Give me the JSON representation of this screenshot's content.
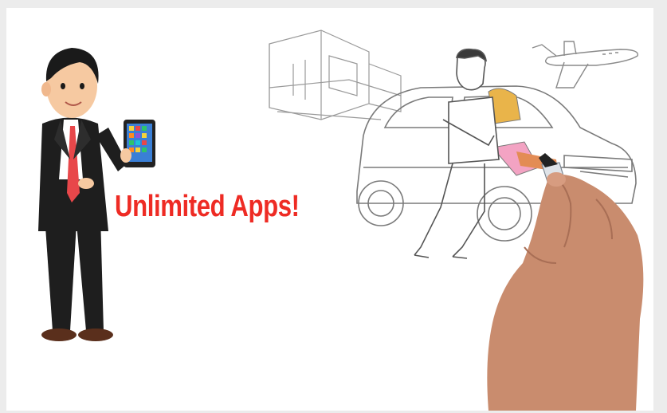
{
  "headline": {
    "text": "Unlimited Apps!"
  },
  "colors": {
    "headline": "#ee2b24",
    "background": "#ffffff",
    "border": "#ececec",
    "suit": "#1e1e1e",
    "tie": "#e8474a",
    "skin": "#f6c9a1",
    "hand": "#c98c6e",
    "sketch": "#8a8a8a",
    "tablet_screen": "#3a7fd6"
  },
  "icons": {
    "businessman": "cartoon-businessman-with-tablet",
    "tablet": "tablet-icon",
    "house": "modern-house-sketch",
    "car": "suv-sketch",
    "man": "sketched-man-leaning",
    "jet": "private-jet-sketch",
    "hand": "drawing-hand-with-marker"
  }
}
